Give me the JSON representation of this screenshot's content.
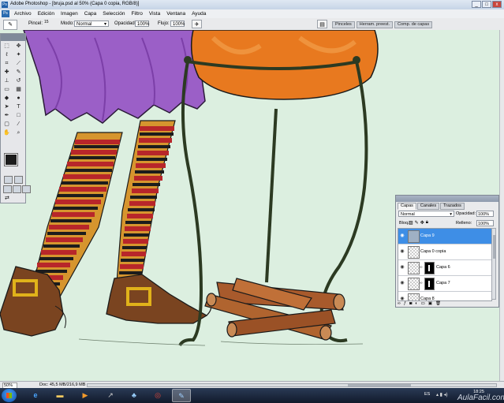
{
  "window": {
    "app_icon": "Ps",
    "title": "Adobe Photoshop - [bruja.psd al 50% (Capa 0 copia, RGB/8)]",
    "buttons": [
      "_",
      "□",
      "x"
    ]
  },
  "menu": {
    "items": [
      "Archivo",
      "Edición",
      "Imagen",
      "Capa",
      "Selección",
      "Filtro",
      "Vista",
      "Ventana",
      "Ayuda"
    ]
  },
  "options": {
    "brush_label": "Pincel:",
    "brush_size": "15",
    "mode_label": "Modo:",
    "mode_value": "Normal",
    "opacity_label": "Opacidad:",
    "opacity_value": "100%",
    "flow_label": "Flujo:",
    "flow_value": "100%"
  },
  "dock_tabs": [
    "Pinceles",
    "Herram. preest.",
    "Comp. de capas"
  ],
  "tools": {
    "icons": [
      "move-icon",
      "marquee-icon",
      "lasso-icon",
      "magic-wand-icon",
      "crop-icon",
      "slice-icon",
      "healing-icon",
      "brush-icon",
      "stamp-icon",
      "history-brush-icon",
      "eraser-icon",
      "gradient-icon",
      "blur-icon",
      "dodge-icon",
      "path-select-icon",
      "type-icon",
      "pen-icon",
      "shape-icon",
      "notes-icon",
      "eyedropper-icon",
      "hand-icon",
      "zoom-icon"
    ]
  },
  "layers": {
    "tabs": [
      "Capas",
      "Canales",
      "Trazados"
    ],
    "active_tab": "Capas",
    "blend_mode": "Normal",
    "opacity_label": "Opacidad:",
    "opacity_value": "100%",
    "lock_label": "Bloq.:",
    "fill_label": "Relleno:",
    "fill_value": "100%",
    "items": [
      {
        "name": "Capa 9",
        "selected": true
      },
      {
        "name": "Capa 0 copia",
        "selected": false
      },
      {
        "name": "Capa 6",
        "selected": false
      },
      {
        "name": "Capa 7",
        "selected": false
      },
      {
        "name": "Capa 8",
        "selected": false
      }
    ]
  },
  "status": {
    "zoom": "50%",
    "doc": "Doc: 45,5 MB/216,9 MB"
  },
  "taskbar": {
    "language": "ES",
    "time": "18:25"
  },
  "watermark": "AulaFacil.com",
  "colors": {
    "canvas_bg": "#dcefe0",
    "selected_layer": "#3e8ee6",
    "dress": "#9b5fc7",
    "cauldron": "#e8791f",
    "boot": "#7a4420",
    "log": "#a85a2c"
  }
}
